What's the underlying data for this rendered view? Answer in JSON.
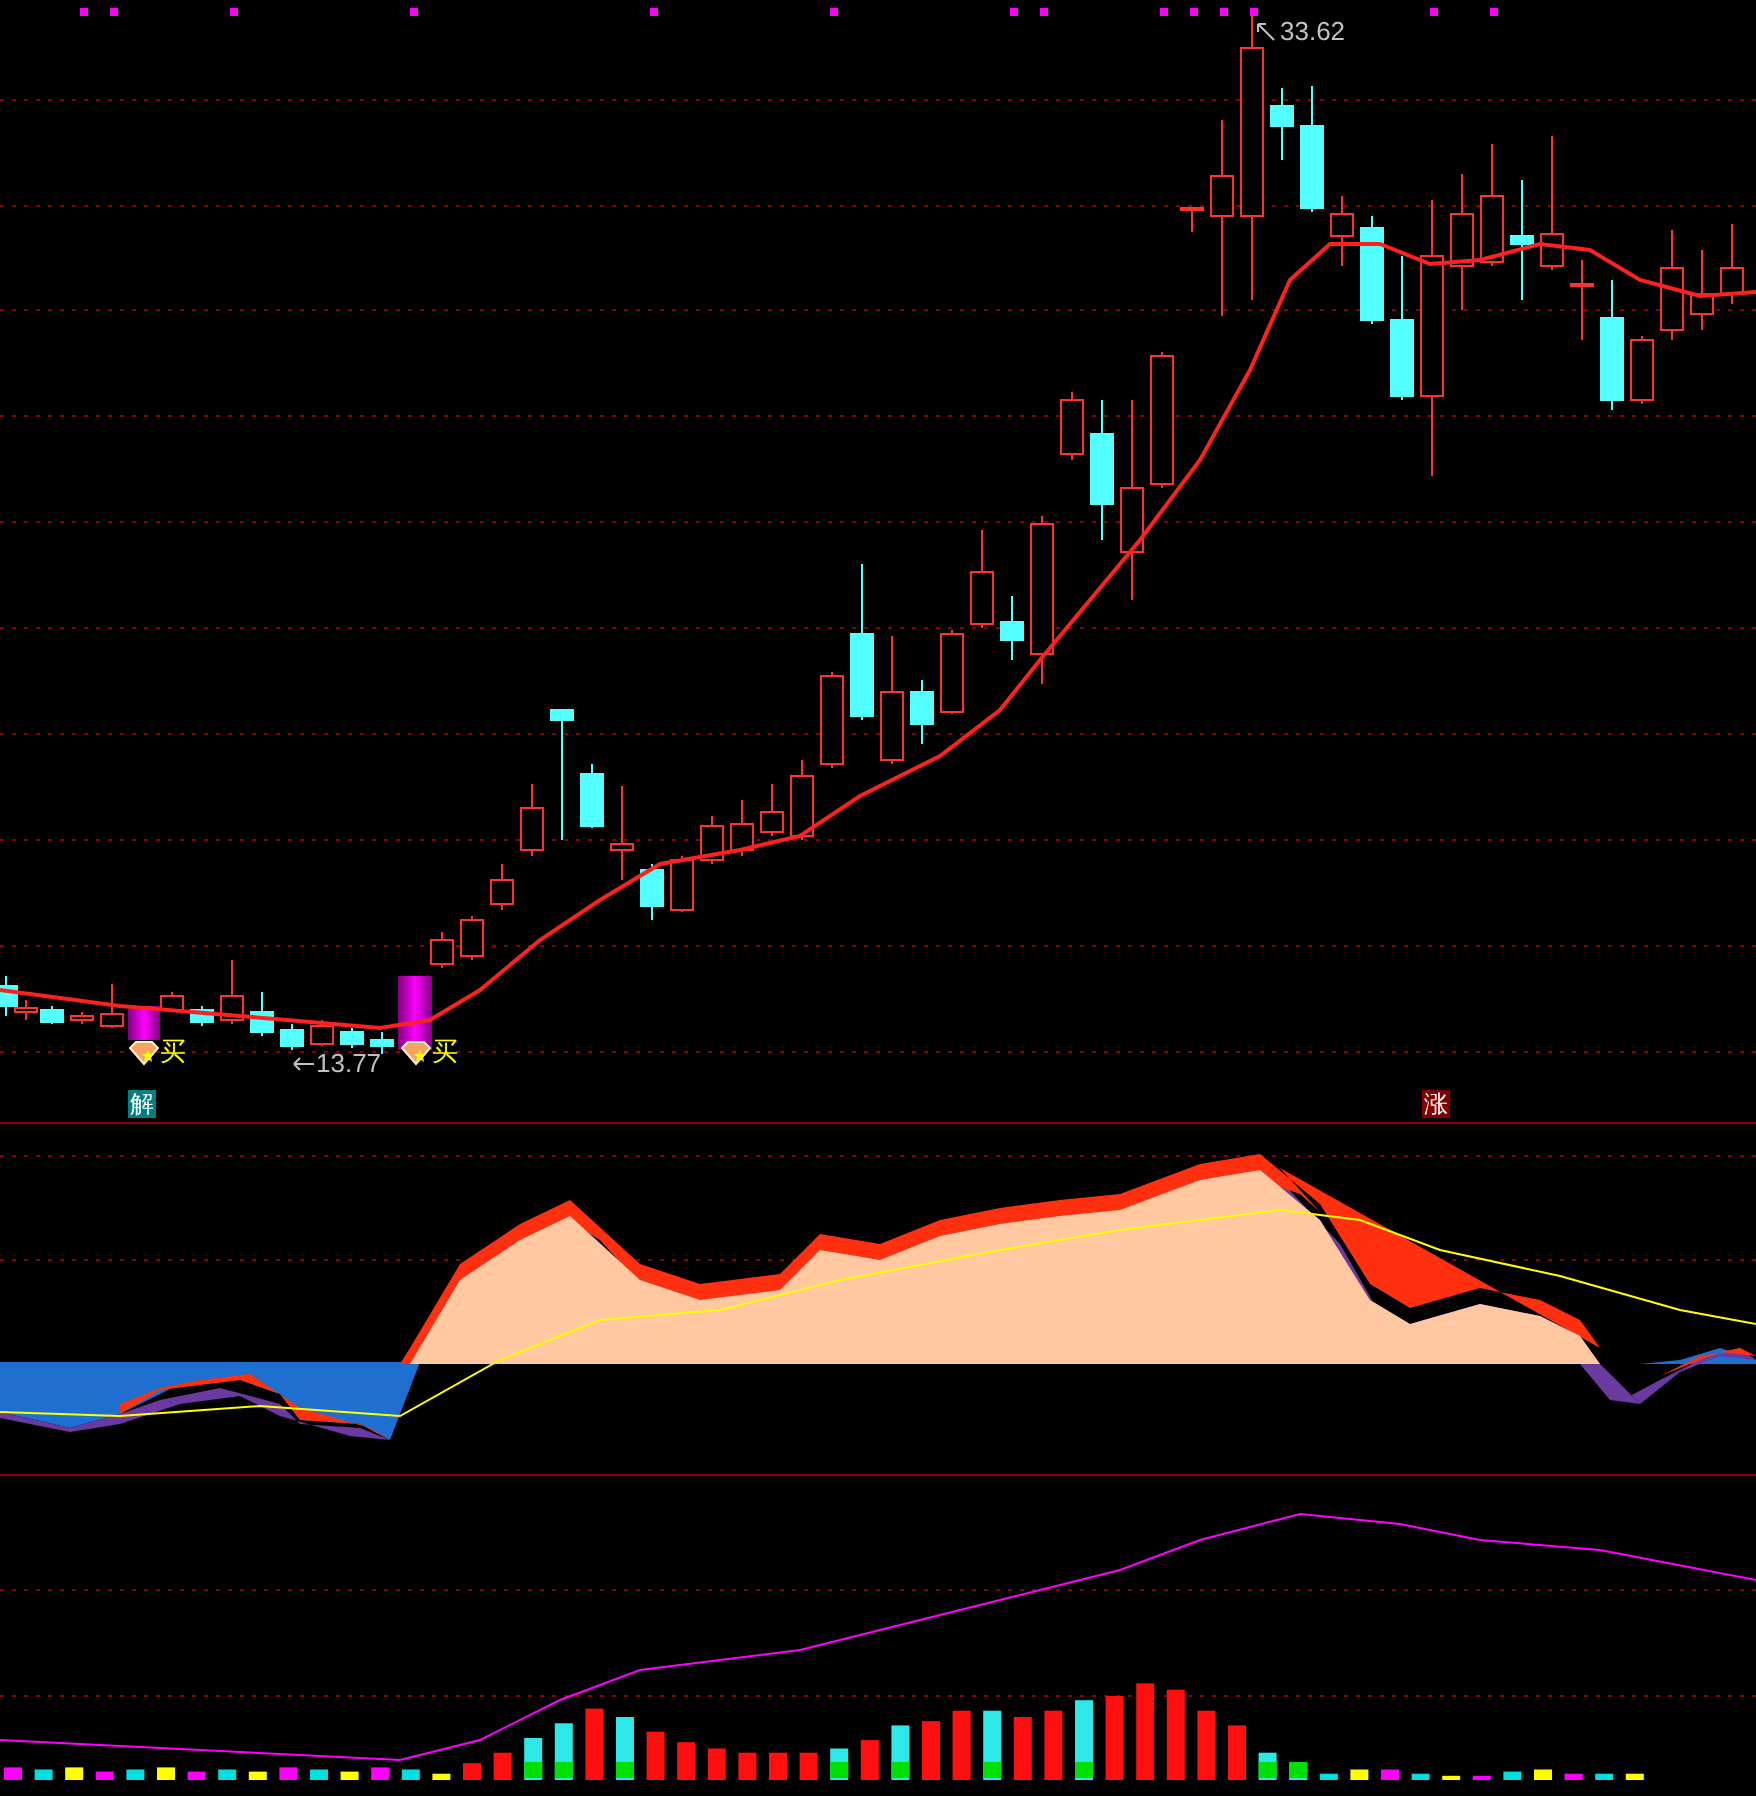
{
  "price_panel": {
    "high_label": "33.62",
    "low_label": "13.77",
    "signals": [
      {
        "label": "买"
      },
      {
        "label": "买"
      }
    ],
    "markers": [
      {
        "label": "解",
        "color": "#008080"
      },
      {
        "label": "涨",
        "color": "#800000"
      }
    ]
  }
}
